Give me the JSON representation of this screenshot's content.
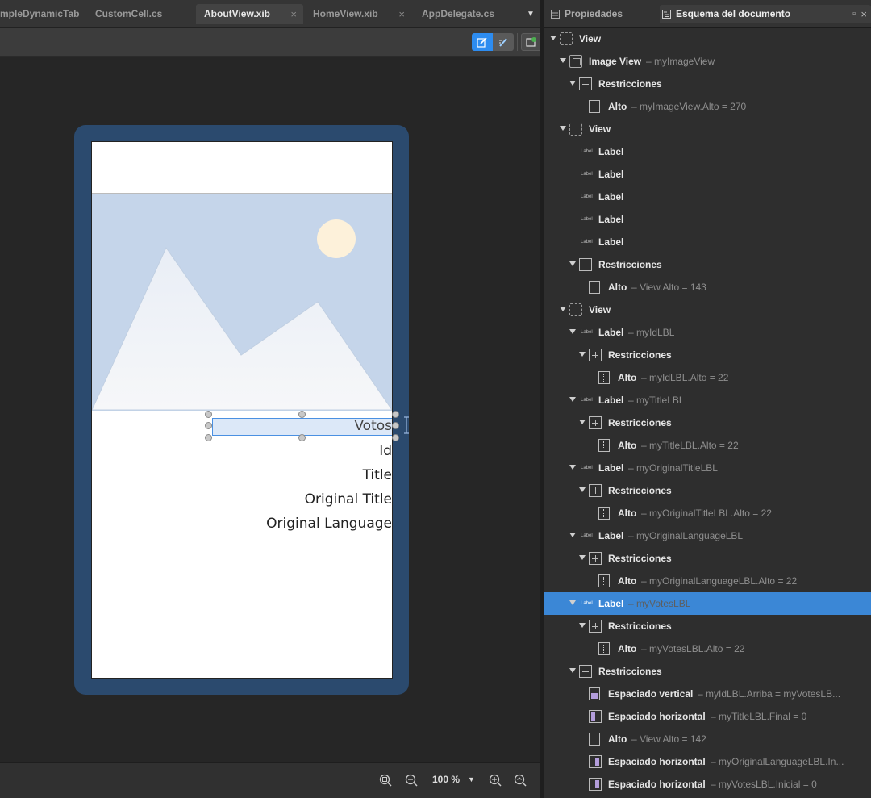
{
  "tabs": [
    {
      "label": "mpleDynamicTabl",
      "active": false,
      "closable": false
    },
    {
      "label": "CustomCell.cs",
      "active": false,
      "closable": false
    },
    {
      "label": "AboutView.xib",
      "active": true,
      "closable": true
    },
    {
      "label": "HomeView.xib",
      "active": false,
      "closable": true
    },
    {
      "label": "AppDelegate.cs",
      "active": false,
      "closable": false
    }
  ],
  "toolbar": {
    "edit_icon": "edit-constraints-icon",
    "paint_icon": "paint-icon",
    "preview_icon": "preview-icon",
    "accent_color": "#2d8cf0"
  },
  "canvas": {
    "device_color": "#2b4a6e",
    "labels": {
      "votes": "Votos",
      "id": "Id",
      "title": "Title",
      "original_title": "Original Title",
      "original_language": "Original Language"
    }
  },
  "statusbar": {
    "zoom": "100 %",
    "icons": [
      "zoom-fit-icon",
      "zoom-out-icon",
      "zoom-in-icon",
      "zoom-reset-icon"
    ]
  },
  "panel": {
    "tab_properties": "Propiedades",
    "tab_outline": "Esquema del documento",
    "pin": "▫",
    "close": "×"
  },
  "outline": [
    {
      "level": 0,
      "arrow": true,
      "icon": "view",
      "name": "View",
      "sub": ""
    },
    {
      "level": 1,
      "arrow": true,
      "icon": "image",
      "name": "Image View",
      "sub": "–  myImageView"
    },
    {
      "level": 2,
      "arrow": true,
      "icon": "cons",
      "name": "Restricciones",
      "sub": ""
    },
    {
      "level": 3,
      "arrow": false,
      "icon": "height",
      "name": "Alto",
      "sub": "–  myImageView.Alto = 270"
    },
    {
      "level": 1,
      "arrow": true,
      "icon": "view",
      "name": "View",
      "sub": ""
    },
    {
      "level": 2,
      "arrow": false,
      "icon": "label",
      "name": "Label",
      "sub": ""
    },
    {
      "level": 2,
      "arrow": false,
      "icon": "label",
      "name": "Label",
      "sub": ""
    },
    {
      "level": 2,
      "arrow": false,
      "icon": "label",
      "name": "Label",
      "sub": ""
    },
    {
      "level": 2,
      "arrow": false,
      "icon": "label",
      "name": "Label",
      "sub": ""
    },
    {
      "level": 2,
      "arrow": false,
      "icon": "label",
      "name": "Label",
      "sub": ""
    },
    {
      "level": 2,
      "arrow": true,
      "icon": "cons",
      "name": "Restricciones",
      "sub": ""
    },
    {
      "level": 3,
      "arrow": false,
      "icon": "height",
      "name": "Alto",
      "sub": "–  View.Alto = 143"
    },
    {
      "level": 1,
      "arrow": true,
      "icon": "view",
      "name": "View",
      "sub": ""
    },
    {
      "level": 2,
      "arrow": true,
      "icon": "label",
      "name": "Label",
      "sub": "–  myIdLBL"
    },
    {
      "level": 3,
      "arrow": true,
      "icon": "cons",
      "name": "Restricciones",
      "sub": ""
    },
    {
      "level": 4,
      "arrow": false,
      "icon": "height",
      "name": "Alto",
      "sub": "–  myIdLBL.Alto = 22"
    },
    {
      "level": 2,
      "arrow": true,
      "icon": "label",
      "name": "Label",
      "sub": "–  myTitleLBL"
    },
    {
      "level": 3,
      "arrow": true,
      "icon": "cons",
      "name": "Restricciones",
      "sub": ""
    },
    {
      "level": 4,
      "arrow": false,
      "icon": "height",
      "name": "Alto",
      "sub": "–  myTitleLBL.Alto = 22"
    },
    {
      "level": 2,
      "arrow": true,
      "icon": "label",
      "name": "Label",
      "sub": "–  myOriginalTitleLBL"
    },
    {
      "level": 3,
      "arrow": true,
      "icon": "cons",
      "name": "Restricciones",
      "sub": ""
    },
    {
      "level": 4,
      "arrow": false,
      "icon": "height",
      "name": "Alto",
      "sub": "–  myOriginalTitleLBL.Alto = 22"
    },
    {
      "level": 2,
      "arrow": true,
      "icon": "label",
      "name": "Label",
      "sub": "–  myOriginalLanguageLBL"
    },
    {
      "level": 3,
      "arrow": true,
      "icon": "cons",
      "name": "Restricciones",
      "sub": ""
    },
    {
      "level": 4,
      "arrow": false,
      "icon": "height",
      "name": "Alto",
      "sub": "–  myOriginalLanguageLBL.Alto = 22"
    },
    {
      "level": 2,
      "arrow": true,
      "icon": "label",
      "name": "Label",
      "sub": "–  myVotesLBL",
      "selected": true
    },
    {
      "level": 3,
      "arrow": true,
      "icon": "cons",
      "name": "Restricciones",
      "sub": ""
    },
    {
      "level": 4,
      "arrow": false,
      "icon": "height",
      "name": "Alto",
      "sub": "–  myVotesLBL.Alto = 22"
    },
    {
      "level": 2,
      "arrow": true,
      "icon": "cons",
      "name": "Restricciones",
      "sub": ""
    },
    {
      "level": 3,
      "arrow": false,
      "icon": "vspace",
      "name": "Espaciado vertical",
      "sub": "–  myIdLBL.Arriba = myVotesLB..."
    },
    {
      "level": 3,
      "arrow": false,
      "icon": "hspace",
      "name": "Espaciado horizontal",
      "sub": "–  myTitleLBL.Final = 0"
    },
    {
      "level": 3,
      "arrow": false,
      "icon": "height",
      "name": "Alto",
      "sub": "–  View.Alto = 142"
    },
    {
      "level": 3,
      "arrow": false,
      "icon": "hspace2",
      "name": "Espaciado horizontal",
      "sub": "–  myOriginalLanguageLBL.In..."
    },
    {
      "level": 3,
      "arrow": false,
      "icon": "hspace2",
      "name": "Espaciado horizontal",
      "sub": "–  myVotesLBL.Inicial = 0"
    }
  ]
}
